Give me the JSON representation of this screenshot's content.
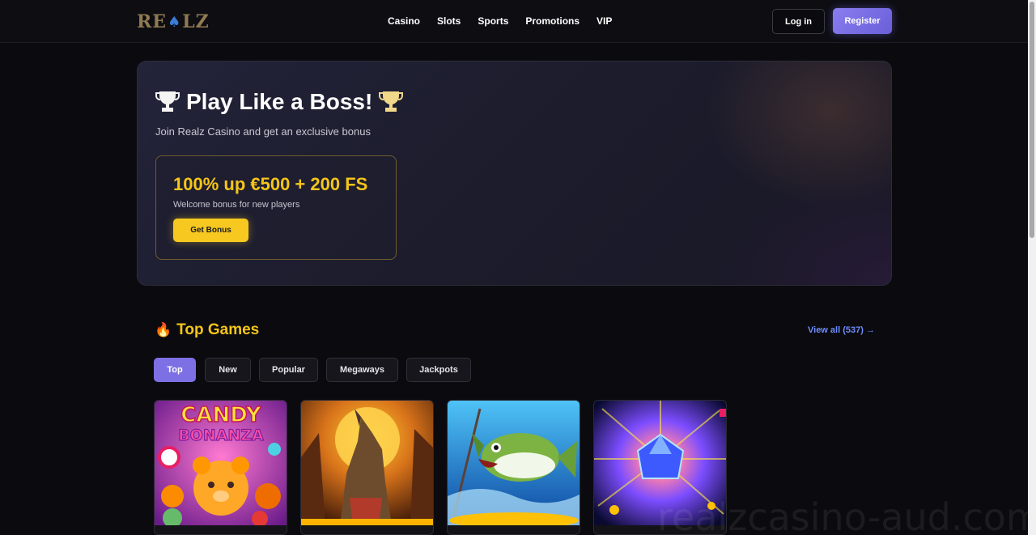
{
  "brand": {
    "logo_left": "RE",
    "logo_right": "LZ"
  },
  "nav": {
    "items": [
      "Casino",
      "Slots",
      "Sports",
      "Promotions",
      "VIP"
    ]
  },
  "auth": {
    "login_label": "Log in",
    "register_label": "Register"
  },
  "hero": {
    "title": "Play Like a Boss!",
    "subtitle": "Join Realz Casino and get an exclusive bonus",
    "bonus_amount": "100% up €500 + 200 FS",
    "bonus_desc": "Welcome bonus for new players",
    "cta_label": "Get Bonus"
  },
  "top_games": {
    "title": "Top Games",
    "view_all": "View all (537) →",
    "tabs": [
      "Top",
      "New",
      "Popular",
      "Megaways",
      "Jackpots"
    ],
    "active_tab": "Top",
    "games": [
      {
        "art_text_1": "CANDY",
        "art_text_2": "BONANZA"
      },
      {
        "art_text_1": "",
        "art_text_2": ""
      },
      {
        "art_text_1": "",
        "art_text_2": ""
      },
      {
        "art_text_1": "",
        "art_text_2": ""
      }
    ]
  },
  "watermark": "realzcasino-aud.com",
  "colors": {
    "accent": "#7d70e4",
    "gold": "#f5c518",
    "link": "#6f8cff",
    "background": "#0b0b0f"
  }
}
